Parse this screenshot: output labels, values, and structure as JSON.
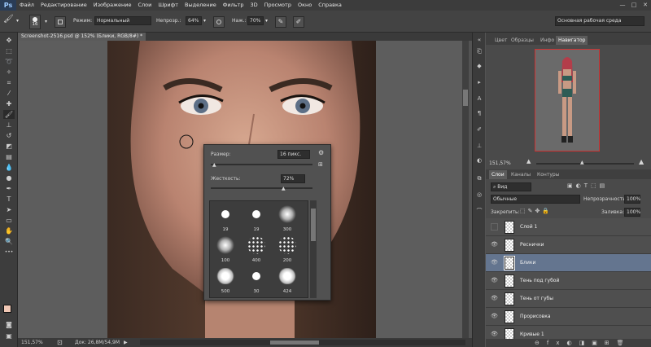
{
  "app": {
    "logo": "Ps",
    "menu": [
      "Файл",
      "Редактирование",
      "Изображение",
      "Слои",
      "Шрифт",
      "Выделение",
      "Фильтр",
      "3D",
      "Просмотр",
      "Окно",
      "Справка"
    ],
    "window_buttons": [
      "—",
      "□",
      "✕"
    ]
  },
  "options": {
    "brush_size": "16",
    "mode_label": "Режим:",
    "mode_value": "Нормальный",
    "opacity_label": "Непрозр.:",
    "opacity_value": "64%",
    "flow_label": "Наж.:",
    "flow_value": "70%",
    "workspace": "Основная рабочая среда"
  },
  "document": {
    "tab": "Screenshot-2516.psd @ 152% (Блики, RGB/8#) *",
    "zoom": "151,57%",
    "doc_info": "Док: 26,8M/54,9M"
  },
  "brush_popup": {
    "size_label": "Размер:",
    "size_value": "16 пикс.",
    "hardness_label": "Жесткость:",
    "hardness_value": "72%",
    "size_fraction": 0.04,
    "hardness_fraction": 0.72,
    "presets": [
      {
        "label": "19",
        "kind": "hard"
      },
      {
        "label": "19",
        "kind": "hard"
      },
      {
        "label": "300",
        "kind": "soft"
      },
      {
        "label": "100",
        "kind": "soft"
      },
      {
        "label": "400",
        "kind": "spatter"
      },
      {
        "label": "200",
        "kind": "spatter"
      },
      {
        "label": "500",
        "kind": "chalk"
      },
      {
        "label": "30",
        "kind": "hard"
      },
      {
        "label": "424",
        "kind": "chalk"
      }
    ]
  },
  "panels": {
    "top_tabs": [
      "Цвет",
      "Образцы",
      "Инфо",
      "Навигатор"
    ],
    "navigator_zoom": "151,57%",
    "layer_tabs": [
      "Слои",
      "Каналы",
      "Контуры"
    ],
    "filter_value": "Вид",
    "blend_mode": "Обычные",
    "opacity_label": "Непрозрачность:",
    "opacity_value": "100%",
    "lock_label": "Закрепить:",
    "fill_label": "Заливка:",
    "fill_value": "100%",
    "layers": [
      {
        "name": "Слой 1",
        "visible": false,
        "selected": false
      },
      {
        "name": "Реснички",
        "visible": true,
        "selected": false
      },
      {
        "name": "Блики",
        "visible": true,
        "selected": true
      },
      {
        "name": "Тень под губой",
        "visible": true,
        "selected": false
      },
      {
        "name": "Тень от губы",
        "visible": true,
        "selected": false
      },
      {
        "name": "Прорисовка",
        "visible": true,
        "selected": false
      },
      {
        "name": "Кривые 1",
        "visible": true,
        "selected": false
      }
    ]
  },
  "colors": {
    "foreground": "#f2c9b6",
    "background": "#ffffff",
    "selected_layer": "#64758f"
  }
}
